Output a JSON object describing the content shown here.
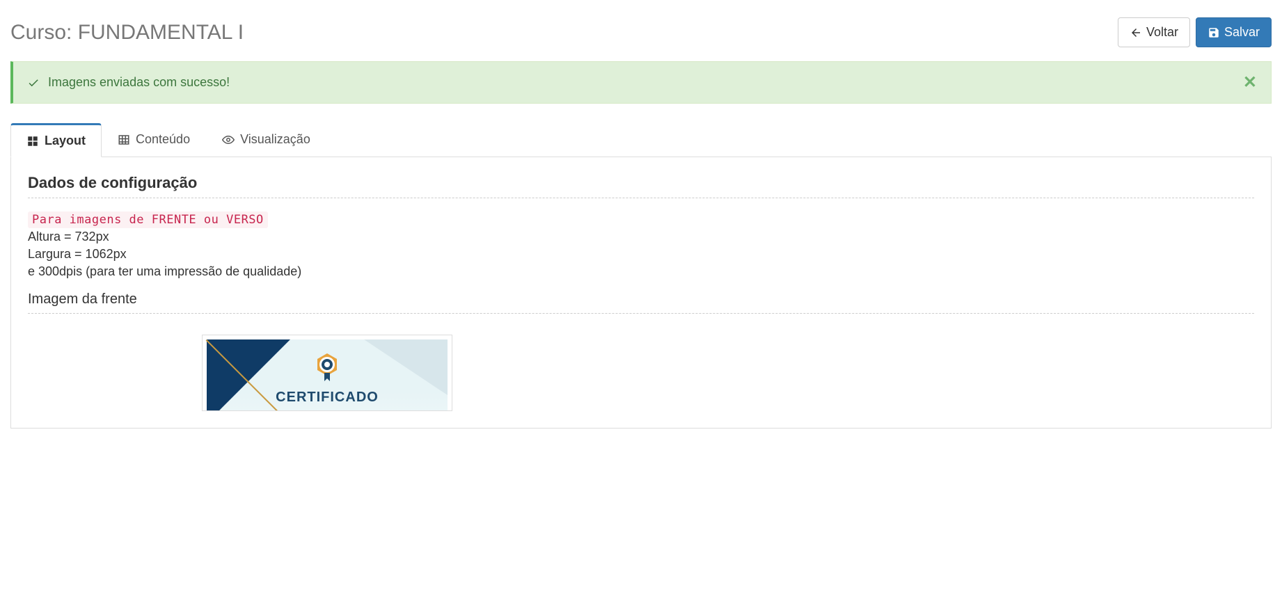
{
  "header": {
    "title": "Curso: FUNDAMENTAL I",
    "back_label": "Voltar",
    "save_label": "Salvar"
  },
  "alert": {
    "message": "Imagens enviadas com sucesso!"
  },
  "tabs": [
    {
      "label": "Layout",
      "icon": "grid-icon",
      "active": true
    },
    {
      "label": "Conteúdo",
      "icon": "table-icon",
      "active": false
    },
    {
      "label": "Visualização",
      "icon": "eye-icon",
      "active": false
    }
  ],
  "layout_tab": {
    "config_heading": "Dados de configuração",
    "code_hint": "Para imagens de FRENTE ou VERSO",
    "height_line": "Altura = 732px",
    "width_line": "Largura = 1062px",
    "dpi_line": "e 300dpis (para ter uma impressão de qualidade)",
    "front_image_heading": "Imagem da frente",
    "cert_preview_title": "CERTIFICADO"
  }
}
